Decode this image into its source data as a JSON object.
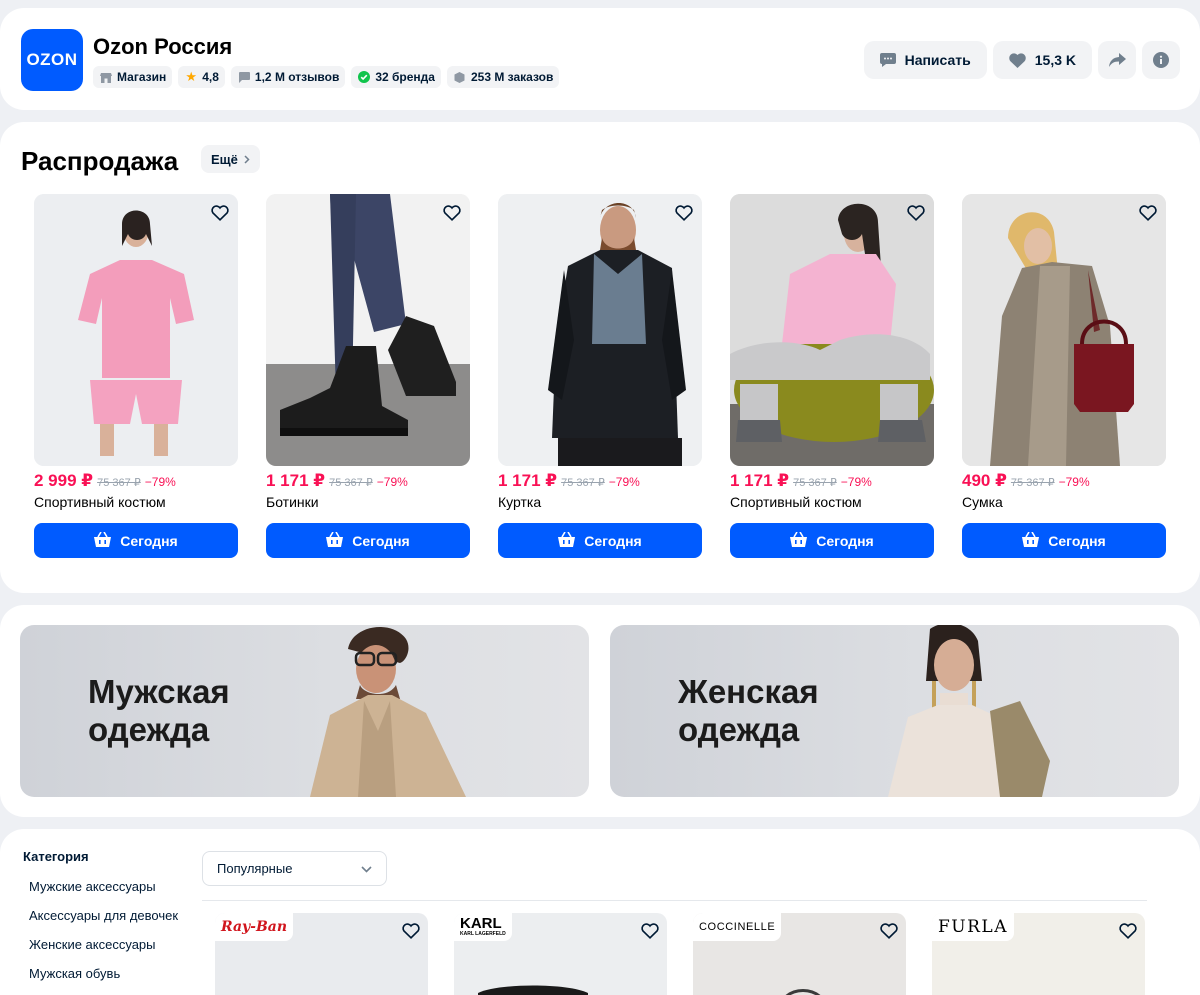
{
  "store": {
    "logo_text": "OZON",
    "name": "Ozon Россия",
    "badges": [
      {
        "icon": "shop-icon",
        "label": "Магазин"
      },
      {
        "icon": "star-icon",
        "label": "4,8"
      },
      {
        "icon": "chat-icon",
        "label": "1,2 М отзывов"
      },
      {
        "icon": "check-icon",
        "label": "32 бренда"
      },
      {
        "icon": "box-icon",
        "label": "253 М заказов"
      }
    ],
    "actions": {
      "write_label": "Написать",
      "favorites_count": "15,3 K"
    }
  },
  "sale": {
    "title": "Распродажа",
    "more_label": "Ещё",
    "buy_label": "Сегодня",
    "products": [
      {
        "price": "2 999 ₽",
        "old_price": "75 367 ₽",
        "discount": "−79%",
        "name": "Спортивный костюм"
      },
      {
        "price": "1 171 ₽",
        "old_price": "75 367 ₽",
        "discount": "−79%",
        "name": "Ботинки"
      },
      {
        "price": "1 171 ₽",
        "old_price": "75 367 ₽",
        "discount": "−79%",
        "name": "Куртка"
      },
      {
        "price": "1 171 ₽",
        "old_price": "75 367 ₽",
        "discount": "−79%",
        "name": "Спортивный костюм"
      },
      {
        "price": "490 ₽",
        "old_price": "75 367 ₽",
        "discount": "−79%",
        "name": "Сумка"
      }
    ]
  },
  "banners": {
    "men_line1": "Мужская",
    "men_line2": "одежда",
    "women_line1": "Женская",
    "women_line2": "одежда"
  },
  "catalog": {
    "category_heading": "Категория",
    "categories": [
      "Мужские аксессуары",
      "Аксессуары для девочек",
      "Женские аксессуары",
      "Мужская обувь"
    ],
    "sort_value": "Популярные",
    "brands": [
      "Ray-Ban",
      "KARL",
      "KARL LAGERFELD",
      "COCCINELLE",
      "FURLA"
    ]
  },
  "colors": {
    "accent": "#005bff",
    "sale_price": "#f91155",
    "background": "#eef0f4"
  }
}
